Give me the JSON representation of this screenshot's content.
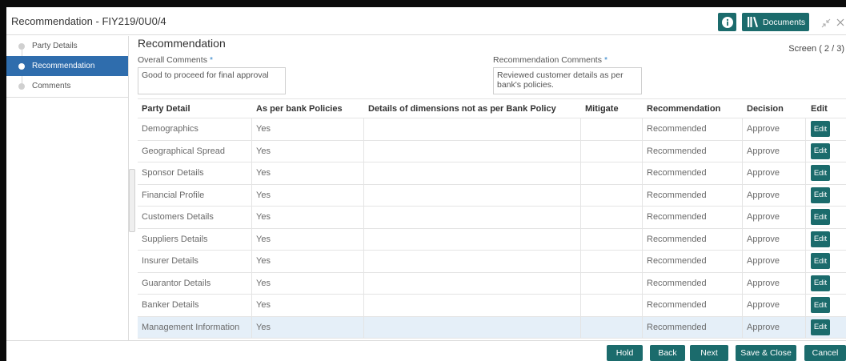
{
  "window": {
    "title": "Recommendation - FIY219/0U0/4",
    "documents_label": "Documents"
  },
  "icons": {
    "info": "info-icon",
    "documents": "books-icon",
    "minimize": "shrink-icon",
    "close": "close-icon",
    "step": "step-dot-icon"
  },
  "colors": {
    "accent": "#1b6b6c",
    "sidebar_active": "#2f6dad",
    "row_highlight": "#e5eff8",
    "required_marker": "#2f82c9"
  },
  "sidebar": {
    "items": [
      {
        "label": "Party Details",
        "active": false
      },
      {
        "label": "Recommendation",
        "active": true
      },
      {
        "label": "Comments",
        "active": false
      }
    ]
  },
  "main": {
    "title": "Recommendation",
    "screen_indicator": "Screen ( 2 / 3)",
    "overall_comments": {
      "label": "Overall Comments",
      "required_marker": "*",
      "value": "Good to proceed for final approval"
    },
    "recommendation_comments": {
      "label": "Recommendation Comments",
      "required_marker": "*",
      "value": "Reviewed customer details as per bank's policies."
    },
    "table": {
      "columns": [
        {
          "key": "party_detail",
          "label": "Party Detail"
        },
        {
          "key": "as_per_bank_policies",
          "label": "As per bank Policies"
        },
        {
          "key": "details_not_as_per_bank_policy",
          "label": "Details of dimensions not as per Bank Policy"
        },
        {
          "key": "mitigate",
          "label": "Mitigate"
        },
        {
          "key": "recommendation",
          "label": "Recommendation"
        },
        {
          "key": "decision",
          "label": "Decision"
        },
        {
          "key": "edit",
          "label": "Edit"
        }
      ],
      "rows": [
        {
          "party_detail": "Demographics",
          "as_per_bank_policies": "Yes",
          "details_not_as_per_bank_policy": "",
          "mitigate": "",
          "recommendation": "Recommended",
          "decision": "Approve",
          "edit": "Edit",
          "selected": false
        },
        {
          "party_detail": "Geographical Spread",
          "as_per_bank_policies": "Yes",
          "details_not_as_per_bank_policy": "",
          "mitigate": "",
          "recommendation": "Recommended",
          "decision": "Approve",
          "edit": "Edit",
          "selected": false
        },
        {
          "party_detail": "Sponsor Details",
          "as_per_bank_policies": "Yes",
          "details_not_as_per_bank_policy": "",
          "mitigate": "",
          "recommendation": "Recommended",
          "decision": "Approve",
          "edit": "Edit",
          "selected": false
        },
        {
          "party_detail": "Financial Profile",
          "as_per_bank_policies": "Yes",
          "details_not_as_per_bank_policy": "",
          "mitigate": "",
          "recommendation": "Recommended",
          "decision": "Approve",
          "edit": "Edit",
          "selected": false
        },
        {
          "party_detail": "Customers Details",
          "as_per_bank_policies": "Yes",
          "details_not_as_per_bank_policy": "",
          "mitigate": "",
          "recommendation": "Recommended",
          "decision": "Approve",
          "edit": "Edit",
          "selected": false
        },
        {
          "party_detail": "Suppliers Details",
          "as_per_bank_policies": "Yes",
          "details_not_as_per_bank_policy": "",
          "mitigate": "",
          "recommendation": "Recommended",
          "decision": "Approve",
          "edit": "Edit",
          "selected": false
        },
        {
          "party_detail": "Insurer Details",
          "as_per_bank_policies": "Yes",
          "details_not_as_per_bank_policy": "",
          "mitigate": "",
          "recommendation": "Recommended",
          "decision": "Approve",
          "edit": "Edit",
          "selected": false
        },
        {
          "party_detail": "Guarantor Details",
          "as_per_bank_policies": "Yes",
          "details_not_as_per_bank_policy": "",
          "mitigate": "",
          "recommendation": "Recommended",
          "decision": "Approve",
          "edit": "Edit",
          "selected": false
        },
        {
          "party_detail": "Banker Details",
          "as_per_bank_policies": "Yes",
          "details_not_as_per_bank_policy": "",
          "mitigate": "",
          "recommendation": "Recommended",
          "decision": "Approve",
          "edit": "Edit",
          "selected": false
        },
        {
          "party_detail": "Management Information",
          "as_per_bank_policies": "Yes",
          "details_not_as_per_bank_policy": "",
          "mitigate": "",
          "recommendation": "Recommended",
          "decision": "Approve",
          "edit": "Edit",
          "selected": true
        }
      ]
    }
  },
  "footer": {
    "buttons": [
      {
        "label": "Hold"
      },
      {
        "label": "Back"
      },
      {
        "label": "Next"
      },
      {
        "label": "Save & Close"
      },
      {
        "label": "Cancel"
      }
    ]
  }
}
